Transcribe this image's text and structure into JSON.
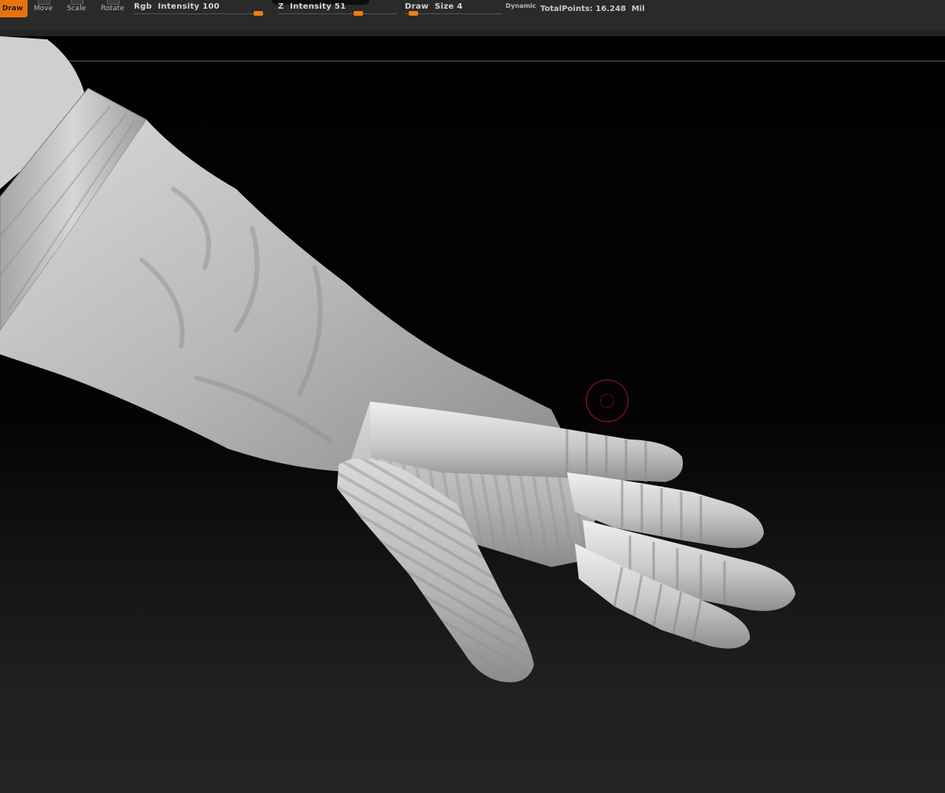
{
  "toolbar": {
    "tools": [
      {
        "label": "Draw",
        "active": true
      },
      {
        "label": "Move",
        "active": false
      },
      {
        "label": "Scale",
        "active": false
      },
      {
        "label": "Rotate",
        "active": false
      }
    ],
    "rgb_intensity": {
      "label": "Rgb  Intensity 100",
      "value": 100
    },
    "z_intensity": {
      "label": "Z  Intensity 51",
      "value": 51
    },
    "draw_size": {
      "label": "Draw  Size 4",
      "value": 4
    },
    "dynamic_label": "Dynamic",
    "total_points": "TotalPoints: 16.248  Mil"
  },
  "colors": {
    "accent": "#f07b12",
    "brush_cursor": "#b3121a"
  }
}
